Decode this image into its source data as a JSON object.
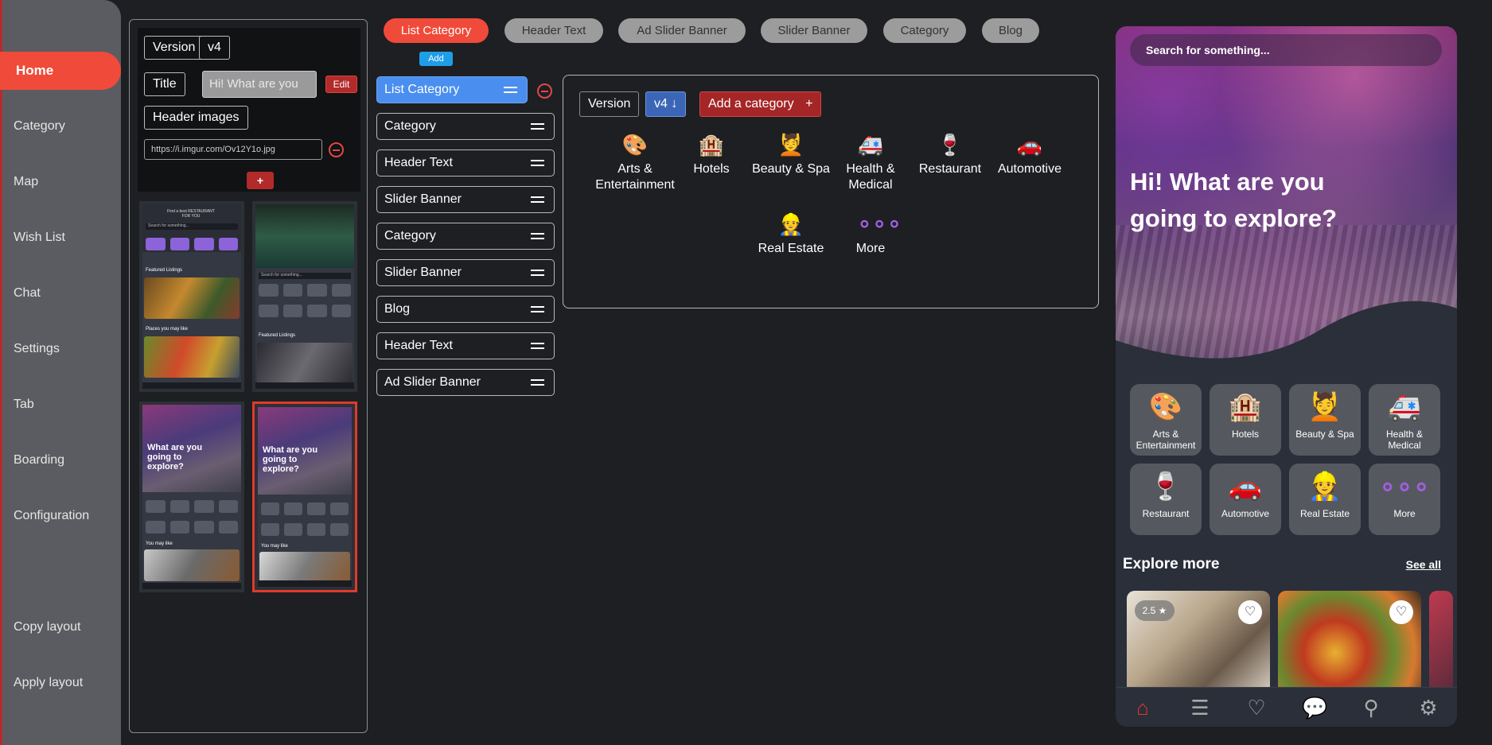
{
  "sidebar": {
    "items": [
      {
        "label": "Home"
      },
      {
        "label": "Category"
      },
      {
        "label": "Map"
      },
      {
        "label": "Wish List"
      },
      {
        "label": "Chat"
      },
      {
        "label": "Settings"
      },
      {
        "label": "Tab"
      },
      {
        "label": "Boarding"
      },
      {
        "label": "Configuration"
      },
      {
        "label": "Copy layout"
      },
      {
        "label": "Apply layout"
      }
    ]
  },
  "settings_form": {
    "version_label": "Version",
    "version_value": "v4",
    "title_label": "Title",
    "title_value": "Hi! What are you",
    "edit_label": "Edit",
    "header_images_label": "Header images",
    "image_url": "https://i.imgur.com/Ov12Y1o.jpg",
    "add_label": "+"
  },
  "thumbnails": {
    "t1": {
      "header": "Find a best RESTAURANT FOR YOU",
      "search": "Search for something...",
      "featured": "Featured Listings",
      "places": "Places you may like"
    },
    "t2": {
      "search": "Search for something...",
      "featured": "Featured Listings"
    },
    "t3": {
      "headline": "What are you going to explore?",
      "you_may_like": "You may like"
    },
    "t4": {
      "headline": "What are you going to explore?",
      "you_may_like": "You may like"
    }
  },
  "tabs": [
    {
      "label": "List Category"
    },
    {
      "label": "Header Text"
    },
    {
      "label": "Ad Slider Banner"
    },
    {
      "label": "Slider Banner"
    },
    {
      "label": "Category"
    },
    {
      "label": "Blog"
    }
  ],
  "add_button_label": "Add",
  "layout_list": [
    {
      "label": "List Category"
    },
    {
      "label": "Category"
    },
    {
      "label": "Header Text"
    },
    {
      "label": "Slider Banner"
    },
    {
      "label": "Category"
    },
    {
      "label": "Slider Banner"
    },
    {
      "label": "Blog"
    },
    {
      "label": "Header Text"
    },
    {
      "label": "Ad Slider Banner"
    }
  ],
  "editor": {
    "version_label": "Version",
    "version_value": "v4",
    "add_category_label": "Add a category",
    "add_category_plus": "+",
    "categories": [
      {
        "label": "Arts & Entertainment",
        "icon": "🎨"
      },
      {
        "label": "Hotels",
        "icon": "🏨"
      },
      {
        "label": "Beauty & Spa",
        "icon": "💆"
      },
      {
        "label": "Health & Medical",
        "icon": "🚑"
      },
      {
        "label": "Restaurant",
        "icon": "🍷"
      },
      {
        "label": "Automotive",
        "icon": "🚗"
      },
      {
        "label": "Real Estate",
        "icon": "👷"
      },
      {
        "label": "More",
        "icon": "∘∘∘"
      }
    ]
  },
  "phone": {
    "search_placeholder": "Search for something...",
    "headline": "Hi! What are you going to explore?",
    "categories": [
      {
        "label": "Arts & Entertainment",
        "icon": "🎨"
      },
      {
        "label": "Hotels",
        "icon": "🏨"
      },
      {
        "label": "Beauty & Spa",
        "icon": "💆"
      },
      {
        "label": "Health & Medical",
        "icon": "🚑"
      },
      {
        "label": "Restaurant",
        "icon": "🍷"
      },
      {
        "label": "Automotive",
        "icon": "🚗"
      },
      {
        "label": "Real Estate",
        "icon": "👷"
      },
      {
        "label": "More",
        "icon": "∘∘∘"
      }
    ],
    "explore_title": "Explore more",
    "see_all": "See all",
    "rating": "2.5 ★",
    "heart": "♡",
    "nav_icons": [
      "home-icon",
      "list-icon",
      "heart-icon",
      "chat-icon",
      "map-pin-icon",
      "gear-icon"
    ]
  },
  "colors": {
    "accent": "#f04a3a",
    "active_list": "#4a8ef0",
    "add_blue": "#1f9ee8",
    "danger": "#b22a2a",
    "more_purple": "#a25ee0"
  }
}
